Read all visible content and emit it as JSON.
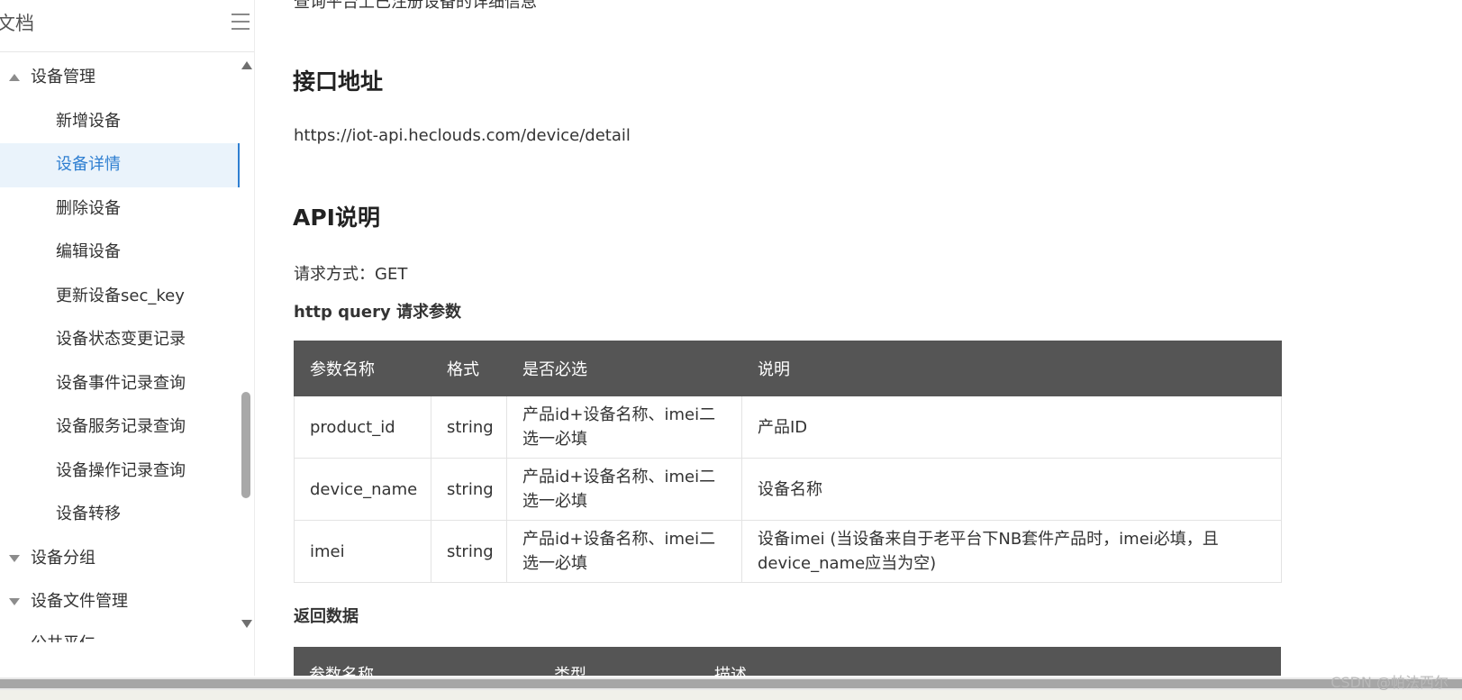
{
  "sidebar": {
    "title": "文档",
    "items": [
      {
        "label": "设备管理",
        "level": 1,
        "expanded": true
      },
      {
        "label": "新增设备",
        "level": 2
      },
      {
        "label": "设备详情",
        "level": 2,
        "active": true
      },
      {
        "label": "删除设备",
        "level": 2
      },
      {
        "label": "编辑设备",
        "level": 2
      },
      {
        "label": "更新设备sec_key",
        "level": 2
      },
      {
        "label": "设备状态变更记录",
        "level": 2
      },
      {
        "label": "设备事件记录查询",
        "level": 2
      },
      {
        "label": "设备服务记录查询",
        "level": 2
      },
      {
        "label": "设备操作记录查询",
        "level": 2
      },
      {
        "label": "设备转移",
        "level": 2
      },
      {
        "label": "设备分组",
        "level": 1,
        "expanded": false
      },
      {
        "label": "设备文件管理",
        "level": 1,
        "expanded": false
      },
      {
        "label": "公共平仁",
        "level": 1,
        "partial": true
      }
    ]
  },
  "content": {
    "intro_text": "查询平台上已注册设备的详细信息",
    "endpoint_heading": "接口地址",
    "endpoint_url": "https://iot-api.heclouds.com/device/detail",
    "api_heading": "API说明",
    "request_method": "请求方式：GET",
    "query_params_heading": "http query 请求参数",
    "params_table": {
      "headers": [
        "参数名称",
        "格式",
        "是否必选",
        "说明"
      ],
      "rows": [
        [
          "product_id",
          "string",
          "产品id+设备名称、imei二选一必填",
          "产品ID"
        ],
        [
          "device_name",
          "string",
          "产品id+设备名称、imei二选一必填",
          "设备名称"
        ],
        [
          "imei",
          "string",
          "产品id+设备名称、imei二选一必填",
          "设备imei (当设备来自于老平台下NB套件产品时，imei必填，且device_name应当为空)"
        ]
      ]
    },
    "return_heading": "返回数据",
    "return_table": {
      "headers": [
        "参数名称",
        "类型",
        "描述"
      ]
    }
  },
  "watermark": "CSDN @帕法西尔",
  "colors": {
    "accent": "#2f7fd1",
    "active_bg": "#eaf3fb",
    "table_header_bg": "#555555",
    "scrollbar_thumb": "#a8a8a8"
  }
}
